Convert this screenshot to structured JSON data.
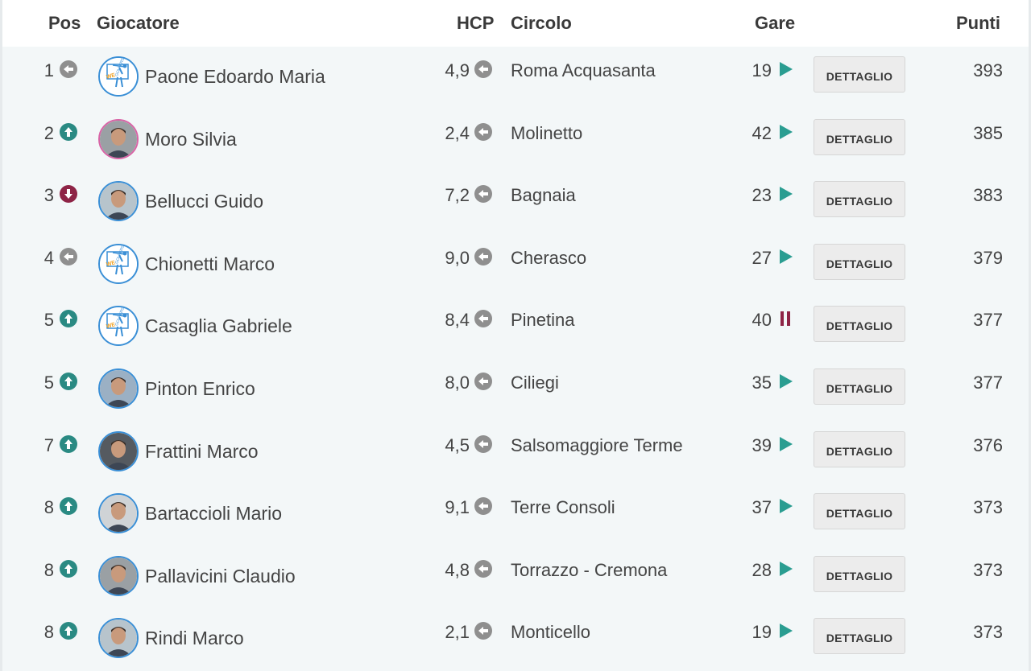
{
  "header": {
    "pos": "Pos",
    "giocatore": "Giocatore",
    "hcp": "HCP",
    "circolo": "Circolo",
    "gare": "Gare",
    "punti": "Punti"
  },
  "colors": {
    "trend_up": "#2a8a83",
    "trend_down": "#8e2446",
    "trend_same": "#8f8f8f",
    "play": "#2a9d91",
    "pause": "#8e2446",
    "row_bg": "#f3f7f8"
  },
  "rows": [
    {
      "pos": "1",
      "trend": "same",
      "name": "Paone Edoardo Maria",
      "avatar": "wegolfers-logo",
      "hcp": "4,9",
      "hcp_trend": "same",
      "club": "Roma Acquasanta",
      "gare": "19",
      "gare_status": "play",
      "button": "DETTAGLIO",
      "punti": "393"
    },
    {
      "pos": "2",
      "trend": "up",
      "name": "Moro Silvia",
      "avatar": "photo",
      "hcp": "2,4",
      "hcp_trend": "same",
      "club": "Molinetto",
      "gare": "42",
      "gare_status": "play",
      "button": "DETTAGLIO",
      "punti": "385"
    },
    {
      "pos": "3",
      "trend": "down",
      "name": "Bellucci Guido",
      "avatar": "photo",
      "hcp": "7,2",
      "hcp_trend": "same",
      "club": "Bagnaia",
      "gare": "23",
      "gare_status": "play",
      "button": "DETTAGLIO",
      "punti": "383"
    },
    {
      "pos": "4",
      "trend": "same",
      "name": "Chionetti Marco",
      "avatar": "wegolfers-logo",
      "hcp": "9,0",
      "hcp_trend": "same",
      "club": "Cherasco",
      "gare": "27",
      "gare_status": "play",
      "button": "DETTAGLIO",
      "punti": "379"
    },
    {
      "pos": "5",
      "trend": "up",
      "name": "Casaglia Gabriele",
      "avatar": "wegolfers-logo",
      "hcp": "8,4",
      "hcp_trend": "same",
      "club": "Pinetina",
      "gare": "40",
      "gare_status": "pause",
      "button": "DETTAGLIO",
      "punti": "377"
    },
    {
      "pos": "5",
      "trend": "up",
      "name": "Pinton Enrico",
      "avatar": "photo",
      "hcp": "8,0",
      "hcp_trend": "same",
      "club": "Ciliegi",
      "gare": "35",
      "gare_status": "play",
      "button": "DETTAGLIO",
      "punti": "377"
    },
    {
      "pos": "7",
      "trend": "up",
      "name": "Frattini Marco",
      "avatar": "photo",
      "hcp": "4,5",
      "hcp_trend": "same",
      "club": "Salsomaggiore Terme",
      "gare": "39",
      "gare_status": "play",
      "button": "DETTAGLIO",
      "punti": "376"
    },
    {
      "pos": "8",
      "trend": "up",
      "name": "Bartaccioli Mario",
      "avatar": "photo",
      "hcp": "9,1",
      "hcp_trend": "same",
      "club": "Terre Consoli",
      "gare": "37",
      "gare_status": "play",
      "button": "DETTAGLIO",
      "punti": "373"
    },
    {
      "pos": "8",
      "trend": "up",
      "name": "Pallavicini Claudio",
      "avatar": "photo",
      "hcp": "4,8",
      "hcp_trend": "same",
      "club": "Torrazzo - Cremona",
      "gare": "28",
      "gare_status": "play",
      "button": "DETTAGLIO",
      "punti": "373"
    },
    {
      "pos": "8",
      "trend": "up",
      "name": "Rindi Marco",
      "avatar": "photo",
      "hcp": "2,1",
      "hcp_trend": "same",
      "club": "Monticello",
      "gare": "19",
      "gare_status": "play",
      "button": "DETTAGLIO",
      "punti": "373"
    }
  ]
}
